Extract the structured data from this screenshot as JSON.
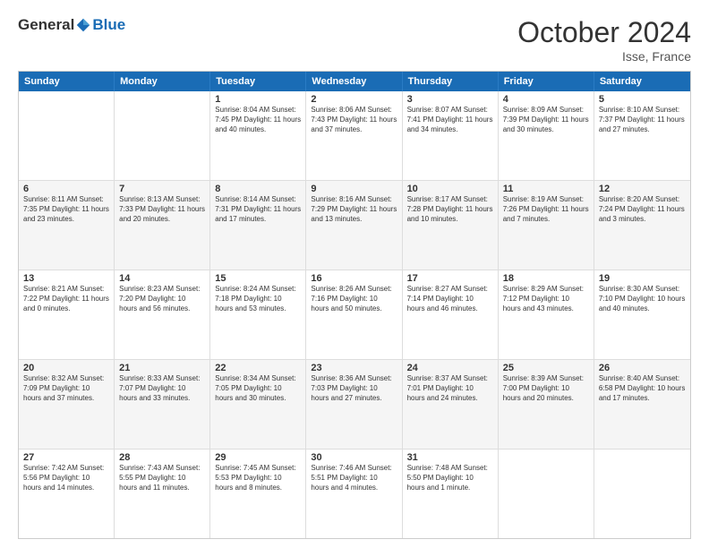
{
  "logo": {
    "general": "General",
    "blue": "Blue"
  },
  "title": "October 2024",
  "location": "Isse, France",
  "weekdays": [
    "Sunday",
    "Monday",
    "Tuesday",
    "Wednesday",
    "Thursday",
    "Friday",
    "Saturday"
  ],
  "rows": [
    [
      {
        "day": "",
        "detail": ""
      },
      {
        "day": "",
        "detail": ""
      },
      {
        "day": "1",
        "detail": "Sunrise: 8:04 AM\nSunset: 7:45 PM\nDaylight: 11 hours\nand 40 minutes."
      },
      {
        "day": "2",
        "detail": "Sunrise: 8:06 AM\nSunset: 7:43 PM\nDaylight: 11 hours\nand 37 minutes."
      },
      {
        "day": "3",
        "detail": "Sunrise: 8:07 AM\nSunset: 7:41 PM\nDaylight: 11 hours\nand 34 minutes."
      },
      {
        "day": "4",
        "detail": "Sunrise: 8:09 AM\nSunset: 7:39 PM\nDaylight: 11 hours\nand 30 minutes."
      },
      {
        "day": "5",
        "detail": "Sunrise: 8:10 AM\nSunset: 7:37 PM\nDaylight: 11 hours\nand 27 minutes."
      }
    ],
    [
      {
        "day": "6",
        "detail": "Sunrise: 8:11 AM\nSunset: 7:35 PM\nDaylight: 11 hours\nand 23 minutes."
      },
      {
        "day": "7",
        "detail": "Sunrise: 8:13 AM\nSunset: 7:33 PM\nDaylight: 11 hours\nand 20 minutes."
      },
      {
        "day": "8",
        "detail": "Sunrise: 8:14 AM\nSunset: 7:31 PM\nDaylight: 11 hours\nand 17 minutes."
      },
      {
        "day": "9",
        "detail": "Sunrise: 8:16 AM\nSunset: 7:29 PM\nDaylight: 11 hours\nand 13 minutes."
      },
      {
        "day": "10",
        "detail": "Sunrise: 8:17 AM\nSunset: 7:28 PM\nDaylight: 11 hours\nand 10 minutes."
      },
      {
        "day": "11",
        "detail": "Sunrise: 8:19 AM\nSunset: 7:26 PM\nDaylight: 11 hours\nand 7 minutes."
      },
      {
        "day": "12",
        "detail": "Sunrise: 8:20 AM\nSunset: 7:24 PM\nDaylight: 11 hours\nand 3 minutes."
      }
    ],
    [
      {
        "day": "13",
        "detail": "Sunrise: 8:21 AM\nSunset: 7:22 PM\nDaylight: 11 hours\nand 0 minutes."
      },
      {
        "day": "14",
        "detail": "Sunrise: 8:23 AM\nSunset: 7:20 PM\nDaylight: 10 hours\nand 56 minutes."
      },
      {
        "day": "15",
        "detail": "Sunrise: 8:24 AM\nSunset: 7:18 PM\nDaylight: 10 hours\nand 53 minutes."
      },
      {
        "day": "16",
        "detail": "Sunrise: 8:26 AM\nSunset: 7:16 PM\nDaylight: 10 hours\nand 50 minutes."
      },
      {
        "day": "17",
        "detail": "Sunrise: 8:27 AM\nSunset: 7:14 PM\nDaylight: 10 hours\nand 46 minutes."
      },
      {
        "day": "18",
        "detail": "Sunrise: 8:29 AM\nSunset: 7:12 PM\nDaylight: 10 hours\nand 43 minutes."
      },
      {
        "day": "19",
        "detail": "Sunrise: 8:30 AM\nSunset: 7:10 PM\nDaylight: 10 hours\nand 40 minutes."
      }
    ],
    [
      {
        "day": "20",
        "detail": "Sunrise: 8:32 AM\nSunset: 7:09 PM\nDaylight: 10 hours\nand 37 minutes."
      },
      {
        "day": "21",
        "detail": "Sunrise: 8:33 AM\nSunset: 7:07 PM\nDaylight: 10 hours\nand 33 minutes."
      },
      {
        "day": "22",
        "detail": "Sunrise: 8:34 AM\nSunset: 7:05 PM\nDaylight: 10 hours\nand 30 minutes."
      },
      {
        "day": "23",
        "detail": "Sunrise: 8:36 AM\nSunset: 7:03 PM\nDaylight: 10 hours\nand 27 minutes."
      },
      {
        "day": "24",
        "detail": "Sunrise: 8:37 AM\nSunset: 7:01 PM\nDaylight: 10 hours\nand 24 minutes."
      },
      {
        "day": "25",
        "detail": "Sunrise: 8:39 AM\nSunset: 7:00 PM\nDaylight: 10 hours\nand 20 minutes."
      },
      {
        "day": "26",
        "detail": "Sunrise: 8:40 AM\nSunset: 6:58 PM\nDaylight: 10 hours\nand 17 minutes."
      }
    ],
    [
      {
        "day": "27",
        "detail": "Sunrise: 7:42 AM\nSunset: 5:56 PM\nDaylight: 10 hours\nand 14 minutes."
      },
      {
        "day": "28",
        "detail": "Sunrise: 7:43 AM\nSunset: 5:55 PM\nDaylight: 10 hours\nand 11 minutes."
      },
      {
        "day": "29",
        "detail": "Sunrise: 7:45 AM\nSunset: 5:53 PM\nDaylight: 10 hours\nand 8 minutes."
      },
      {
        "day": "30",
        "detail": "Sunrise: 7:46 AM\nSunset: 5:51 PM\nDaylight: 10 hours\nand 4 minutes."
      },
      {
        "day": "31",
        "detail": "Sunrise: 7:48 AM\nSunset: 5:50 PM\nDaylight: 10 hours\nand 1 minute."
      },
      {
        "day": "",
        "detail": ""
      },
      {
        "day": "",
        "detail": ""
      }
    ]
  ]
}
